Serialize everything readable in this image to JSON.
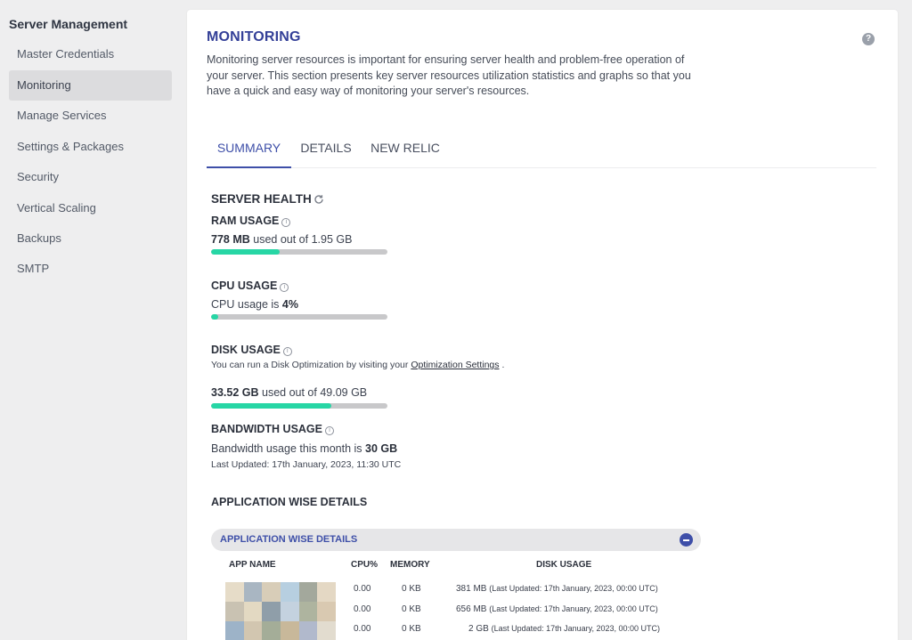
{
  "sidebar": {
    "title": "Server Management",
    "items": [
      {
        "label": "Master Credentials",
        "active": false
      },
      {
        "label": "Monitoring",
        "active": true
      },
      {
        "label": "Manage Services",
        "active": false
      },
      {
        "label": "Settings & Packages",
        "active": false
      },
      {
        "label": "Security",
        "active": false
      },
      {
        "label": "Vertical Scaling",
        "active": false
      },
      {
        "label": "Backups",
        "active": false
      },
      {
        "label": "SMTP",
        "active": false
      }
    ]
  },
  "page": {
    "title": "MONITORING",
    "help_icon": "question-circle-icon",
    "intro": "Monitoring server resources is important for ensuring server health and problem-free operation of your server. This section presents key server resources utilization statistics and graphs so that you have a quick and easy way of monitoring your server's resources."
  },
  "tabs": [
    {
      "label": "SUMMARY",
      "active": true
    },
    {
      "label": "DETAILS",
      "active": false
    },
    {
      "label": "NEW RELIC",
      "active": false
    }
  ],
  "server_health": {
    "title": "SERVER HEALTH",
    "refresh_icon": "refresh-icon",
    "ram": {
      "label": "RAM USAGE",
      "used": "778 MB",
      "rest": " used out of 1.95 GB",
      "fraction": 0.39
    },
    "cpu": {
      "label": "CPU USAGE",
      "prefix": "CPU usage is ",
      "value": "4%",
      "fraction": 0.04
    },
    "disk": {
      "label": "DISK USAGE",
      "note_prefix": "You can run a Disk Optimization by visiting your ",
      "note_link": "Optimization Settings",
      "note_suffix": " .",
      "used": "33.52 GB",
      "rest": " used out of 49.09 GB",
      "fraction": 0.683
    },
    "bandwidth": {
      "label": "BANDWIDTH USAGE",
      "prefix": "Bandwidth usage this month is ",
      "value": "30 GB",
      "updated": "Last Updated: 17th January, 2023, 11:30 UTC"
    }
  },
  "app_details": {
    "title": "APPLICATION WISE DETAILS",
    "accordion_label": "APPLICATION WISE DETAILS",
    "collapse_icon": "minus-circle-icon",
    "columns": [
      "APP NAME",
      "CPU%",
      "MEMORY",
      "DISK USAGE"
    ],
    "rows": [
      {
        "cpu": "0.00",
        "memory": "0 KB",
        "disk": "381 MB",
        "updated": "(Last Updated: 17th January, 2023, 00:00 UTC)"
      },
      {
        "cpu": "0.00",
        "memory": "0 KB",
        "disk": "656 MB",
        "updated": "(Last Updated: 17th January, 2023, 00:00 UTC)"
      },
      {
        "cpu": "0.00",
        "memory": "0 KB",
        "disk": "2 GB",
        "updated": "(Last Updated: 17th January, 2023, 00:00 UTC)"
      }
    ],
    "thumbnail_colors": [
      "#e6dcc8",
      "#a9b6c2",
      "#d8cdb8",
      "#b7cfe0",
      "#a3a89c",
      "#e4d8c4",
      "#c9c2b2",
      "#e3d9c2",
      "#8f9ea9",
      "#c4d2df",
      "#aeb49f",
      "#d9c9b1",
      "#9db3c8",
      "#d2c6b0",
      "#a4ad98",
      "#c8b89a",
      "#b1b9cc",
      "#e2dccf"
    ]
  }
}
